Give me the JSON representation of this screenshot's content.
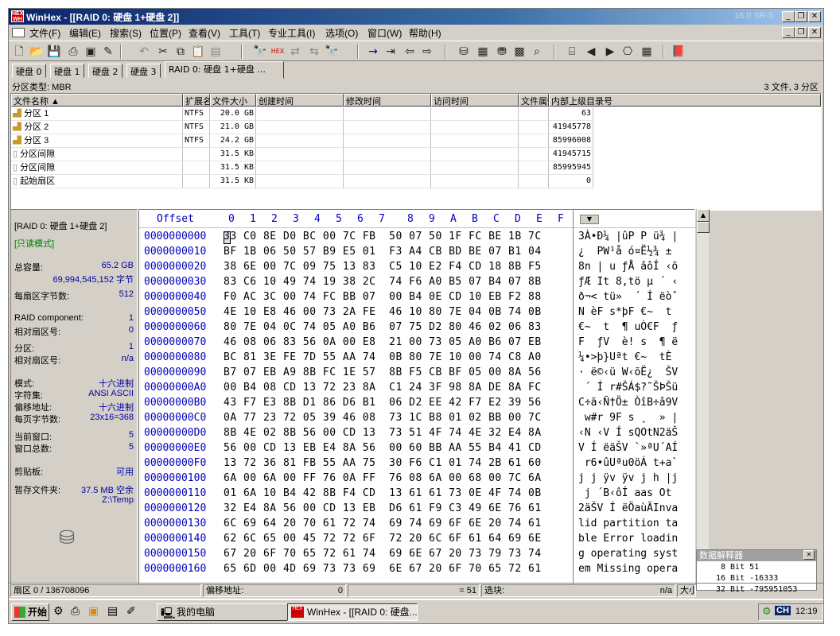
{
  "window": {
    "title": "WinHex - [[RAID 0: 硬盘 1+硬盘 2]]",
    "title_right": "16.0 SR-5"
  },
  "menu": [
    "文件(F)",
    "编辑(E)",
    "搜索(S)",
    "位置(P)",
    "查看(V)",
    "工具(T)",
    "专业工具(I)",
    "选项(O)",
    "窗口(W)",
    "帮助(H)"
  ],
  "tabs": [
    "硬盘 0",
    "硬盘 1",
    "硬盘 2",
    "硬盘 3",
    "RAID 0: 硬盘 1+硬盘 ..."
  ],
  "info": {
    "partition_type": "分区类型: MBR",
    "count": "3 文件, 3 分区"
  },
  "columns": [
    "文件名称 ▲",
    "扩展名",
    "文件大小",
    "创建时间",
    "修改时间",
    "访问时间",
    "文件属性",
    "内部上级目录号"
  ],
  "files": [
    {
      "name": "分区 1",
      "ext": "NTFS",
      "size": "20.0 GB",
      "parent": "63"
    },
    {
      "name": "分区 2",
      "ext": "NTFS",
      "size": "21.0 GB",
      "parent": "41945778"
    },
    {
      "name": "分区 3",
      "ext": "NTFS",
      "size": "24.2 GB",
      "parent": "85996008"
    },
    {
      "name": "分区间隙",
      "ext": "",
      "size": "31.5 KB",
      "parent": "41945715"
    },
    {
      "name": "分区间隙",
      "ext": "",
      "size": "31.5 KB",
      "parent": "85995945"
    },
    {
      "name": "起始扇区",
      "ext": "",
      "size": "31.5 KB",
      "parent": "0"
    }
  ],
  "panel": {
    "title": "[RAID 0: 硬盘 1+硬盘 2]",
    "readonly": "[只读模式]",
    "capacity_label": "总容量:",
    "capacity_value": "65.2 GB",
    "capacity_bytes": "69,994,545,152 字节",
    "bps_label": "每扇区字节数:",
    "bps_value": "512",
    "raid_label": "RAID component:",
    "raid_value": "1",
    "rel_label": "相对扇区号:",
    "rel_value": "0",
    "part_label": "分区:",
    "part_value": "1",
    "rel2_label": "相对扇区号:",
    "rel2_value": "n/a",
    "mode_label": "模式:",
    "mode_value": "十六进制",
    "charset_label": "字符集:",
    "charset_value": "ANSI ASCII",
    "offset_label": "偏移地址:",
    "offset_value": "十六进制",
    "bpp_label": "每页字节数:",
    "bpp_value": "23x16=368",
    "curwin_label": "当前窗口:",
    "curwin_value": "5",
    "totwin_label": "窗口总数:",
    "totwin_value": "5",
    "clip_label": "剪贴板:",
    "clip_value": "可用",
    "temp_label": "暂存文件夹:",
    "temp_value": "37.5 MB 空余",
    "temp_path": "Z:\\Temp"
  },
  "hex": {
    "offset_header": "Offset",
    "col_headers": [
      "0",
      "1",
      "2",
      "3",
      "4",
      "5",
      "6",
      "7",
      "8",
      "9",
      "A",
      "B",
      "C",
      "D",
      "E",
      "F"
    ],
    "rows": [
      {
        "off": "0000000000",
        "hex": "33 C0 8E D0 BC 00 7C FB  50 07 50 1F FC BE 1B 7C",
        "asc": "3À•Ð¼ |ûP P ü¾ |"
      },
      {
        "off": "0000000010",
        "hex": "BF 1B 06 50 57 B9 E5 01  F3 A4 CB BD BE 07 B1 04",
        "asc": "¿  PW¹å ó¤Ë½¾ ±"
      },
      {
        "off": "0000000020",
        "hex": "38 6E 00 7C 09 75 13 83  C5 10 E2 F4 CD 18 8B F5",
        "asc": "8n | u ƒÅ âôÍ ‹õ"
      },
      {
        "off": "0000000030",
        "hex": "83 C6 10 49 74 19 38 2C  74 F6 A0 B5 07 B4 07 8B",
        "asc": "ƒÆ It 8,tö µ ´ ‹"
      },
      {
        "off": "0000000040",
        "hex": "F0 AC 3C 00 74 FC BB 07  00 B4 0E CD 10 EB F2 88",
        "asc": "ð¬< tü»  ´ Í ëòˆ"
      },
      {
        "off": "0000000050",
        "hex": "4E 10 E8 46 00 73 2A FE  46 10 80 7E 04 0B 74 0B",
        "asc": "N èF s*þF €~  t"
      },
      {
        "off": "0000000060",
        "hex": "80 7E 04 0C 74 05 A0 B6  07 75 D2 80 46 02 06 83",
        "asc": "€~  t  ¶ uÒ€F  ƒ"
      },
      {
        "off": "0000000070",
        "hex": "46 08 06 83 56 0A 00 E8  21 00 73 05 A0 B6 07 EB",
        "asc": "F  ƒV  è! s  ¶ ë"
      },
      {
        "off": "0000000080",
        "hex": "BC 81 3E FE 7D 55 AA 74  0B 80 7E 10 00 74 C8 A0",
        "asc": "¼•>þ}Uªt €~  tÈ "
      },
      {
        "off": "0000000090",
        "hex": "B7 07 EB A9 8B FC 1E 57  8B F5 CB BF 05 00 8A 56",
        "asc": "· ë©‹ü W‹õË¿  ŠV"
      },
      {
        "off": "00000000A0",
        "hex": "00 B4 08 CD 13 72 23 8A  C1 24 3F 98 8A DE 8A FC",
        "asc": " ´ Í r#ŠÁ$?˜ŠÞŠü"
      },
      {
        "off": "00000000B0",
        "hex": "43 F7 E3 8B D1 86 D6 B1  06 D2 EE 42 F7 E2 39 56",
        "asc": "C÷ã‹Ñ†Ö± ÒîB÷â9V"
      },
      {
        "off": "00000000C0",
        "hex": "0A 77 23 72 05 39 46 08  73 1C B8 01 02 BB 00 7C",
        "asc": " w#r 9F s ¸  » |"
      },
      {
        "off": "00000000D0",
        "hex": "8B 4E 02 8B 56 00 CD 13  73 51 4F 74 4E 32 E4 8A",
        "asc": "‹N ‹V Í sQOtN2äŠ"
      },
      {
        "off": "00000000E0",
        "hex": "56 00 CD 13 EB E4 8A 56  00 60 BB AA 55 B4 41 CD",
        "asc": "V Í ëäŠV `»ªU´AÍ"
      },
      {
        "off": "00000000F0",
        "hex": "13 72 36 81 FB 55 AA 75  30 F6 C1 01 74 2B 61 60",
        "asc": " r6•ûUªu0öÁ t+a`"
      },
      {
        "off": "0000000100",
        "hex": "6A 00 6A 00 FF 76 0A FF  76 08 6A 00 68 00 7C 6A",
        "asc": "j j ÿv ÿv j h |j"
      },
      {
        "off": "0000000110",
        "hex": "01 6A 10 B4 42 8B F4 CD  13 61 61 73 0E 4F 74 0B",
        "asc": " j ´B‹ôÍ aas Ot"
      },
      {
        "off": "0000000120",
        "hex": "32 E4 8A 56 00 CD 13 EB  D6 61 F9 C3 49 6E 76 61",
        "asc": "2äŠV Í ëÖaùÃInva"
      },
      {
        "off": "0000000130",
        "hex": "6C 69 64 20 70 61 72 74  69 74 69 6F 6E 20 74 61",
        "asc": "lid partition ta"
      },
      {
        "off": "0000000140",
        "hex": "62 6C 65 00 45 72 72 6F  72 20 6C 6F 61 64 69 6E",
        "asc": "ble Error loadin"
      },
      {
        "off": "0000000150",
        "hex": "67 20 6F 70 65 72 61 74  69 6E 67 20 73 79 73 74",
        "asc": "g operating syst"
      },
      {
        "off": "0000000160",
        "hex": "65 6D 00 4D 69 73 73 69  6E 67 20 6F 70 65 72 61",
        "asc": "em Missing opera"
      }
    ]
  },
  "interpreter": {
    "title": "数据解释器",
    "b8": "8 Bit 51",
    "b16": "16 Bit -16333",
    "b32": "32 Bit -795951053"
  },
  "status": {
    "sector": "扇区 0 / 136708096",
    "offset_label": "偏移地址:",
    "offset_value": "0",
    "value": "= 51",
    "block_label": "选块:",
    "block_value": "n/a",
    "size_label": "大小"
  },
  "taskbar": {
    "start": "开始",
    "mycomputer": "我的电脑",
    "winhex": "WinHex - [[RAID 0: 硬盘...",
    "lang": "CH",
    "time": "12:19"
  }
}
